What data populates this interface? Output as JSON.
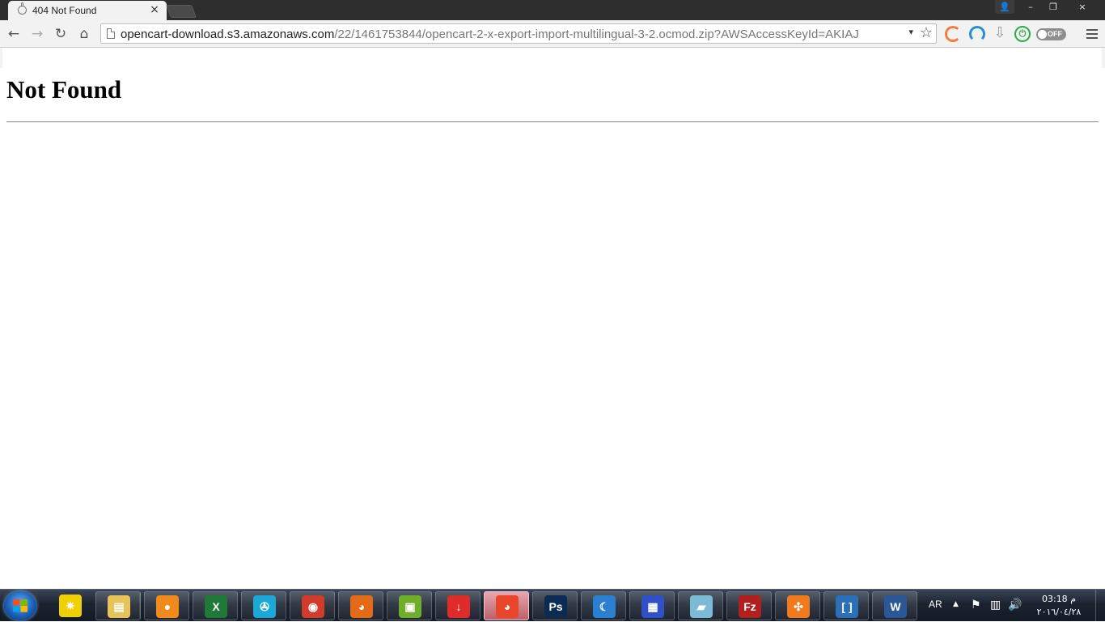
{
  "tab": {
    "title": "404 Not Found",
    "close": "×"
  },
  "window_controls": {
    "profile": "👤",
    "minimize": "–",
    "restore": "❐",
    "close": "×"
  },
  "nav": {
    "back": "←",
    "forward": "→",
    "reload": "↻",
    "home": "⌂"
  },
  "omnibox": {
    "host": "opencart-download.s3.amazonaws.com",
    "path": "/22/1461753844/opencart-2-x-export-import-multilingual-3-2.ocmod.zip?AWSAccessKeyId=AKIAJ",
    "dropdown": "▾",
    "star": "☆"
  },
  "extensions": {
    "toggle_label": "OFF",
    "download": "⇩",
    "power": "⏻"
  },
  "page": {
    "heading": "Not Found"
  },
  "taskbar": {
    "apps": [
      {
        "name": "Bat",
        "glyph": "✷",
        "color": "#f0d000"
      },
      {
        "name": "Windows Explorer",
        "glyph": "▤",
        "color": "#e7c45a"
      },
      {
        "name": "Orange App",
        "glyph": "●",
        "color": "#f08a1a"
      },
      {
        "name": "Excel",
        "glyph": "X",
        "color": "#1f7a3a"
      },
      {
        "name": "Media Player",
        "glyph": "✇",
        "color": "#1aa8d8"
      },
      {
        "name": "Chrome",
        "glyph": "◉",
        "color": "#d23a2c"
      },
      {
        "name": "Firefox",
        "glyph": "◕",
        "color": "#e56a17"
      },
      {
        "name": "VMware",
        "glyph": "▣",
        "color": "#6fae2a"
      },
      {
        "name": "Download Manager",
        "glyph": "↓",
        "color": "#e02b2b"
      },
      {
        "name": "Firefox Dev",
        "glyph": "◕",
        "color": "#e8452a"
      },
      {
        "name": "Photoshop",
        "glyph": "Ps",
        "color": "#0b2b54"
      },
      {
        "name": "Moon App",
        "glyph": "☾",
        "color": "#2a7fd0"
      },
      {
        "name": "Notepad",
        "glyph": "▦",
        "color": "#3050c8"
      },
      {
        "name": "Paper App",
        "glyph": "▰",
        "color": "#7cbad8"
      },
      {
        "name": "FileZilla",
        "glyph": "Fz",
        "color": "#b21f1f"
      },
      {
        "name": "XAMPP",
        "glyph": "✣",
        "color": "#f07a1c"
      },
      {
        "name": "Brackets",
        "glyph": "[ ]",
        "color": "#2a6fb8"
      },
      {
        "name": "Word",
        "glyph": "W",
        "color": "#2b5797"
      }
    ],
    "language": "AR",
    "tray_arrow": "▲",
    "flag_icon": "⚑",
    "network_icon": "▥",
    "volume_icon": "🔊",
    "time": "03:18 م",
    "date": "٢٠١٦/٠٤/٢٨"
  }
}
